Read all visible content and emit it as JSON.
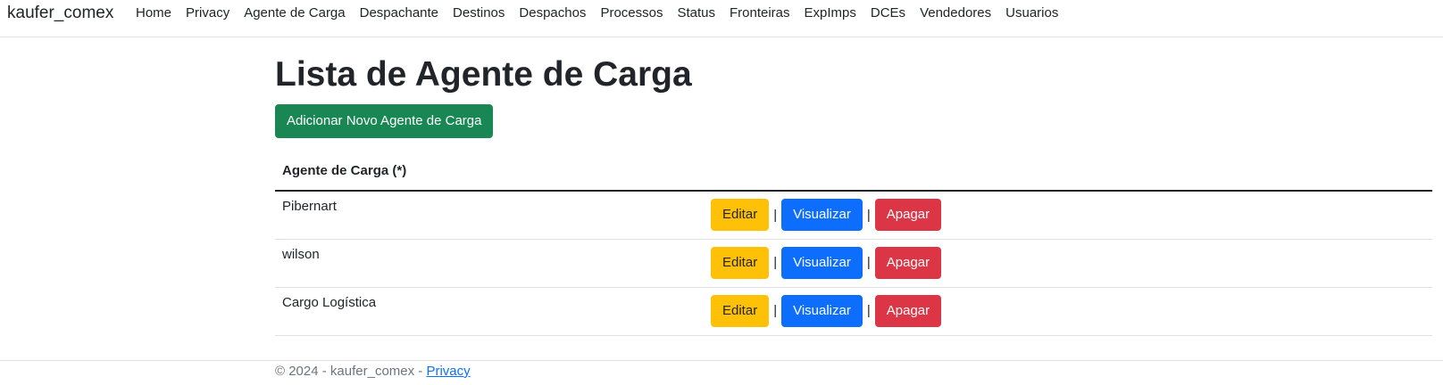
{
  "navbar": {
    "brand": "kaufer_comex",
    "items": [
      {
        "label": "Home"
      },
      {
        "label": "Privacy"
      },
      {
        "label": "Agente de Carga"
      },
      {
        "label": "Despachante"
      },
      {
        "label": "Destinos"
      },
      {
        "label": "Despachos"
      },
      {
        "label": "Processos"
      },
      {
        "label": "Status"
      },
      {
        "label": "Fronteiras"
      },
      {
        "label": "ExpImps"
      },
      {
        "label": "DCEs"
      },
      {
        "label": "Vendedores"
      },
      {
        "label": "Usuarios"
      }
    ]
  },
  "main": {
    "title": "Lista de Agente de Carga",
    "add_button_label": "Adicionar Novo Agente de Carga",
    "table": {
      "header": "Agente de Carga (*)",
      "rows": [
        {
          "name": "Pibernart"
        },
        {
          "name": "wilson"
        },
        {
          "name": "Cargo Logística"
        }
      ],
      "actions": {
        "edit_label": "Editar",
        "view_label": "Visualizar",
        "delete_label": "Apagar",
        "separator": "|"
      }
    }
  },
  "footer": {
    "text": "© 2024 - kaufer_comex - ",
    "link_label": "Privacy"
  },
  "colors": {
    "success": "#198754",
    "warning": "#ffc107",
    "primary": "#0d6efd",
    "danger": "#dc3545"
  }
}
